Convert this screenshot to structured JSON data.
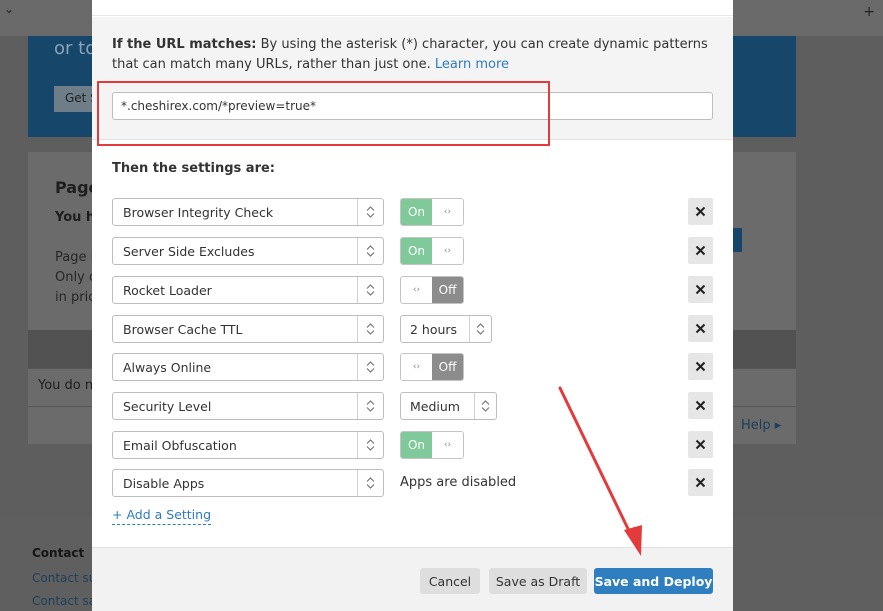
{
  "background": {
    "plus_glyph": "+",
    "chevron_glyph": "⌄",
    "banner_text": "or to",
    "banner_button": "Get S",
    "card_title": "Page",
    "card_subtitle": "You h",
    "card_body_lines": [
      "Page l",
      "Only c",
      "in pric"
    ],
    "row_text": "You do n",
    "help_link": "Help ▸",
    "footer_heading": "Contact",
    "footer_links": [
      "Contact su",
      "Contact sa"
    ]
  },
  "match": {
    "label": "If the URL matches:",
    "description": " By using the asterisk (*) character, you can create dynamic patterns that can match many URLs, rather than just one. ",
    "learn_more": "Learn more",
    "url_value": "*.cheshirex.com/*preview=true*"
  },
  "settings_title": "Then the settings are:",
  "settings": [
    {
      "name": "Browser Integrity Check",
      "control": "toggle",
      "state": "On"
    },
    {
      "name": "Server Side Excludes",
      "control": "toggle",
      "state": "On"
    },
    {
      "name": "Rocket Loader",
      "control": "toggle",
      "state": "Off"
    },
    {
      "name": "Browser Cache TTL",
      "control": "select",
      "value": "2 hours"
    },
    {
      "name": "Always Online",
      "control": "toggle",
      "state": "Off"
    },
    {
      "name": "Security Level",
      "control": "select",
      "value": "Medium"
    },
    {
      "name": "Email Obfuscation",
      "control": "toggle",
      "state": "On"
    },
    {
      "name": "Disable Apps",
      "control": "static",
      "value": "Apps are disabled"
    }
  ],
  "add_setting": "+ Add a Setting",
  "toggle_handle_glyph": "‹›",
  "footer": {
    "cancel": "Cancel",
    "save_draft": "Save as Draft",
    "save_deploy": "Save and Deploy"
  },
  "colors": {
    "toggle_on": "#7fc99a",
    "toggle_off": "#8c8c8c",
    "primary": "#2f7fc0",
    "annotation_red": "#e33b3b"
  }
}
